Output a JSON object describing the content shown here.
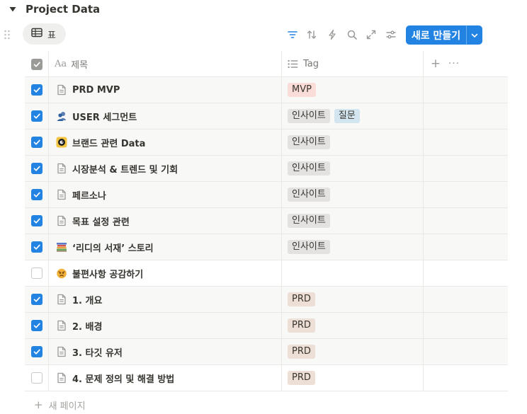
{
  "database": {
    "title": "Project Data"
  },
  "view": {
    "label": "표",
    "icon": "table-icon"
  },
  "toolbar": {
    "icons": [
      "filter-icon",
      "sort-icon",
      "automation-icon",
      "search-icon",
      "expand-icon",
      "settings-icon"
    ],
    "new_button_label": "새로 만들기"
  },
  "columns": {
    "title_icon_text": "Aa",
    "title": "제목",
    "tag": "Tag",
    "add": "+",
    "more": "···"
  },
  "colors": {
    "accent": "#2383e2",
    "tag_mvp_bg": "#fadcd8",
    "tag_insight_bg": "#e3e2e0",
    "tag_question_bg": "#d3e5ef",
    "tag_prd_bg": "#eedfd6"
  },
  "rows": [
    {
      "checked": true,
      "icon": "page-icon",
      "title": "PRD MVP",
      "tags": [
        {
          "label": "MVP",
          "color": "#fadcd8"
        }
      ]
    },
    {
      "checked": true,
      "icon": "users-icon",
      "title": "USER 세그먼트",
      "tags": [
        {
          "label": "인사이트",
          "color": "#e3e2e0"
        },
        {
          "label": "질문",
          "color": "#d3e5ef"
        }
      ]
    },
    {
      "checked": true,
      "icon": "brand-icon",
      "title": "브랜드 관련 Data",
      "tags": [
        {
          "label": "인사이트",
          "color": "#e3e2e0"
        }
      ]
    },
    {
      "checked": true,
      "icon": "page-icon",
      "title": "시장분석 & 트렌드 및 기회",
      "tags": [
        {
          "label": "인사이트",
          "color": "#e3e2e0"
        }
      ]
    },
    {
      "checked": true,
      "icon": "page-icon",
      "title": "페르소나",
      "tags": [
        {
          "label": "인사이트",
          "color": "#e3e2e0"
        }
      ]
    },
    {
      "checked": true,
      "icon": "page-icon",
      "title": "목표 설정 관련",
      "tags": [
        {
          "label": "인사이트",
          "color": "#e3e2e0"
        }
      ]
    },
    {
      "checked": true,
      "icon": "books-icon",
      "title": "‘리디의 서재’ 스토리",
      "tags": [
        {
          "label": "인사이트",
          "color": "#e3e2e0"
        }
      ]
    },
    {
      "checked": false,
      "icon": "angry-face-icon",
      "title": "불편사항 공감하기",
      "tags": []
    },
    {
      "checked": true,
      "icon": "page-icon",
      "title": "1. 개요",
      "tags": [
        {
          "label": "PRD",
          "color": "#eedfd6"
        }
      ]
    },
    {
      "checked": true,
      "icon": "page-icon",
      "title": "2. 배경",
      "tags": [
        {
          "label": "PRD",
          "color": "#eedfd6"
        }
      ]
    },
    {
      "checked": true,
      "icon": "page-icon",
      "title": "3. 타깃 유저",
      "tags": [
        {
          "label": "PRD",
          "color": "#eedfd6"
        }
      ]
    },
    {
      "checked": false,
      "icon": "page-icon",
      "title": "4. 문제 정의 및 해결 방법",
      "tags": [
        {
          "label": "PRD",
          "color": "#eedfd6"
        }
      ]
    }
  ],
  "footer": {
    "new_page_label": "새 페이지",
    "plus": "+"
  }
}
